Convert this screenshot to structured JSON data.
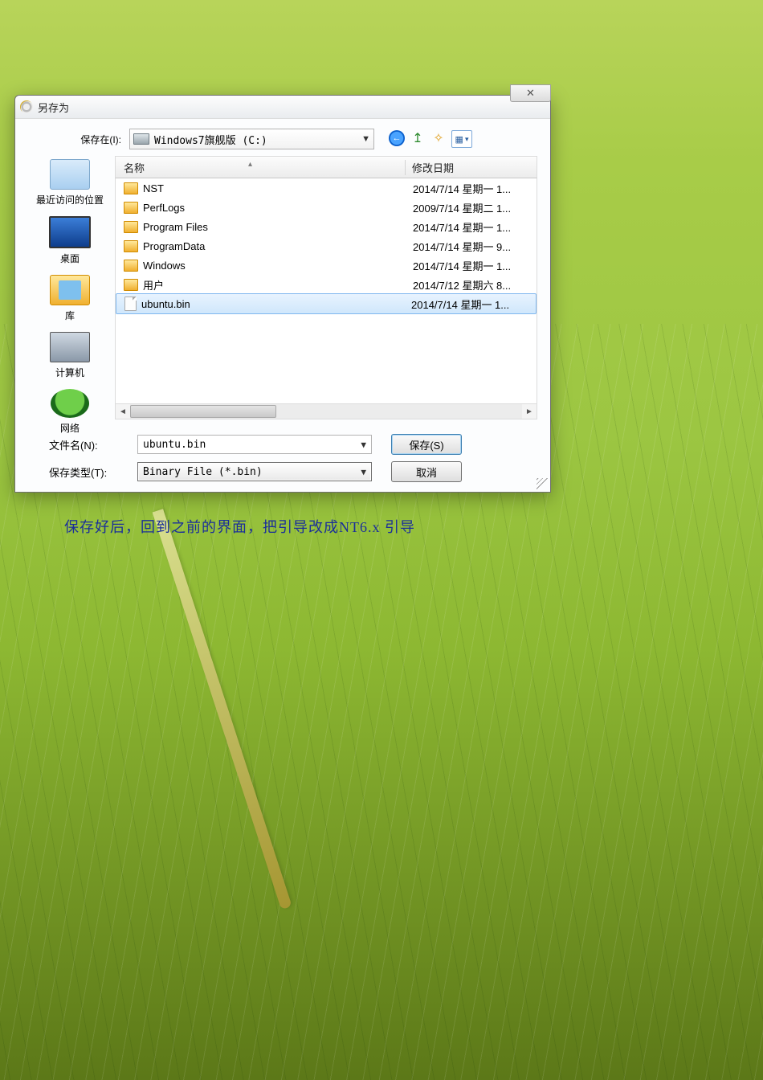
{
  "dialog": {
    "title": "另存为",
    "close_glyph": "✕",
    "save_in_label": "保存在(I):",
    "save_in_value": "Windows7旗舰版 (C:)",
    "columns": {
      "name": "名称",
      "date": "修改日期"
    },
    "files": [
      {
        "icon": "folder",
        "name": "NST",
        "date": "2014/7/14 星期一 1...",
        "selected": false
      },
      {
        "icon": "folder",
        "name": "PerfLogs",
        "date": "2009/7/14 星期二 1...",
        "selected": false
      },
      {
        "icon": "folder",
        "name": "Program Files",
        "date": "2014/7/14 星期一 1...",
        "selected": false
      },
      {
        "icon": "folder",
        "name": "ProgramData",
        "date": "2014/7/14 星期一 9...",
        "selected": false
      },
      {
        "icon": "folder",
        "name": "Windows",
        "date": "2014/7/14 星期一 1...",
        "selected": false
      },
      {
        "icon": "folder",
        "name": "用户",
        "date": "2014/7/12 星期六 8...",
        "selected": false
      },
      {
        "icon": "file",
        "name": "ubuntu.bin",
        "date": "2014/7/14 星期一 1...",
        "selected": true
      }
    ],
    "places": [
      {
        "id": "recent",
        "label": "最近访问的位置"
      },
      {
        "id": "desktop",
        "label": "桌面"
      },
      {
        "id": "library",
        "label": "库"
      },
      {
        "id": "computer",
        "label": "计算机"
      },
      {
        "id": "network",
        "label": "网络"
      }
    ],
    "filename_label": "文件名(N):",
    "filename_value": "ubuntu.bin",
    "filetype_label": "保存类型(T):",
    "filetype_value": "Binary File (*.bin)",
    "save_button": "保存(S)",
    "cancel_button": "取消"
  },
  "caption": "保存好后，回到之前的界面，把引导改成NT6.x 引导"
}
